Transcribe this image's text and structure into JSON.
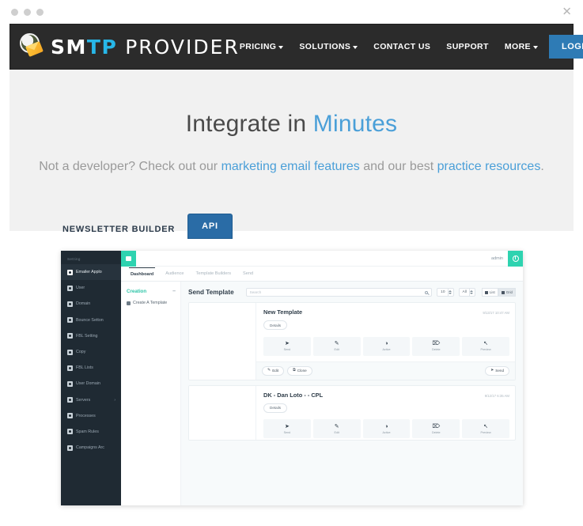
{
  "window": {
    "dots": [
      "dot-1",
      "dot-2",
      "dot-3"
    ],
    "close_label": "✕"
  },
  "navbar": {
    "logo": {
      "part1": "SM",
      "part2": "TP",
      "part3": "PROVIDER",
      "icon": "eagle-envelope-logo"
    },
    "links": [
      {
        "label": "PRICING",
        "has_caret": true
      },
      {
        "label": "SOLUTIONS",
        "has_caret": true
      },
      {
        "label": "CONTACT US",
        "has_caret": false
      },
      {
        "label": "SUPPORT",
        "has_caret": false
      },
      {
        "label": "MORE",
        "has_caret": true
      }
    ],
    "login_label": "LOGIN",
    "background": "#2b2b2b",
    "login_color": "#2e7bb5"
  },
  "hero": {
    "title_plain": "Integrate in ",
    "title_accent": "Minutes",
    "sub_a": "Not a developer? Check out our ",
    "sub_link1": "marketing email features",
    "sub_b": " and our best ",
    "sub_link2": "practice resources",
    "sub_c": ".",
    "accent_color": "#4a9fd8"
  },
  "tabs": [
    {
      "label": "NEWSLETTER BUILDER",
      "active": false
    },
    {
      "label": "API",
      "active": true
    }
  ],
  "app": {
    "sidebar": {
      "section_label": "Setting",
      "items": [
        {
          "label": "Emailer Applo",
          "icon": "gear-icon",
          "active": true
        },
        {
          "label": "User",
          "icon": "user-icon",
          "active": false
        },
        {
          "label": "Domain",
          "icon": "globe-icon",
          "active": false
        },
        {
          "label": "Bounce Setton",
          "icon": "bounce-icon",
          "active": false
        },
        {
          "label": "FBL Setting",
          "icon": "fbl-setting-icon",
          "active": false
        },
        {
          "label": "Copy",
          "icon": "copy-icon",
          "active": false
        },
        {
          "label": "FBL Lists",
          "icon": "list-icon",
          "active": false
        },
        {
          "label": "User Domain",
          "icon": "user-domain-icon",
          "active": false
        },
        {
          "label": "Servers",
          "icon": "server-icon",
          "active": false,
          "chevron": "›"
        },
        {
          "label": "Processes",
          "icon": "processes-icon",
          "active": false
        },
        {
          "label": "Spam Rules",
          "icon": "spam-rules-icon",
          "active": false
        },
        {
          "label": "Campaigns Arc",
          "icon": "campaigns-icon",
          "active": false
        }
      ]
    },
    "topbar": {
      "menu_toggle": "hamburger-icon",
      "admin_label": "admin",
      "power_icon": "power-icon",
      "accent": "#2ed3b0"
    },
    "app_tabs": [
      {
        "label": "Dashboard",
        "active": true
      },
      {
        "label": "Audience",
        "active": false
      },
      {
        "label": "Template Builders",
        "active": false
      },
      {
        "label": "Send",
        "active": false
      }
    ],
    "creation": {
      "heading": "Creation",
      "collapse": "–",
      "items": [
        {
          "label": "Create A Template",
          "icon": "template-icon"
        }
      ],
      "accent": "#2ec5a8"
    },
    "content": {
      "title": "Send Template",
      "search_placeholder": "Search",
      "search_value": "",
      "page_size": "10",
      "filter": "All",
      "view_toggles": [
        {
          "label": "List",
          "active": false
        },
        {
          "label": "Grid",
          "active": true
        }
      ],
      "cards": [
        {
          "title": "New Template",
          "date": "9/13/17 10:47 AM",
          "details_label": "Details",
          "actions": [
            {
              "label": "Send",
              "glyph": "➤",
              "icon": "send-icon"
            },
            {
              "label": "Edit",
              "glyph": "✎",
              "icon": "pencil-icon"
            },
            {
              "label": "Active",
              "glyph": "◑",
              "icon": "toggle-icon"
            },
            {
              "label": "Delete",
              "glyph": "⌦",
              "icon": "trash-icon"
            },
            {
              "label": "Preview",
              "glyph": "↖",
              "icon": "cursor-icon"
            }
          ],
          "footer": {
            "left": [
              {
                "label": "Edit",
                "glyph": "✎",
                "icon": "pencil-icon"
              },
              {
                "label": "Clone",
                "glyph": "⧉",
                "icon": "clone-icon"
              }
            ],
            "right": {
              "label": "Send",
              "glyph": "➤",
              "icon": "send-icon"
            }
          }
        },
        {
          "title": "DK - Dan Loto - - CPL",
          "date": "9/12/17 6:35 AM",
          "details_label": "Details",
          "actions": [
            {
              "label": "Send",
              "glyph": "➤",
              "icon": "send-icon"
            },
            {
              "label": "Edit",
              "glyph": "✎",
              "icon": "pencil-icon"
            },
            {
              "label": "Active",
              "glyph": "◑",
              "icon": "toggle-icon"
            },
            {
              "label": "Delete",
              "glyph": "⌦",
              "icon": "trash-icon"
            },
            {
              "label": "Preview",
              "glyph": "↖",
              "icon": "cursor-icon"
            }
          ]
        }
      ]
    }
  }
}
